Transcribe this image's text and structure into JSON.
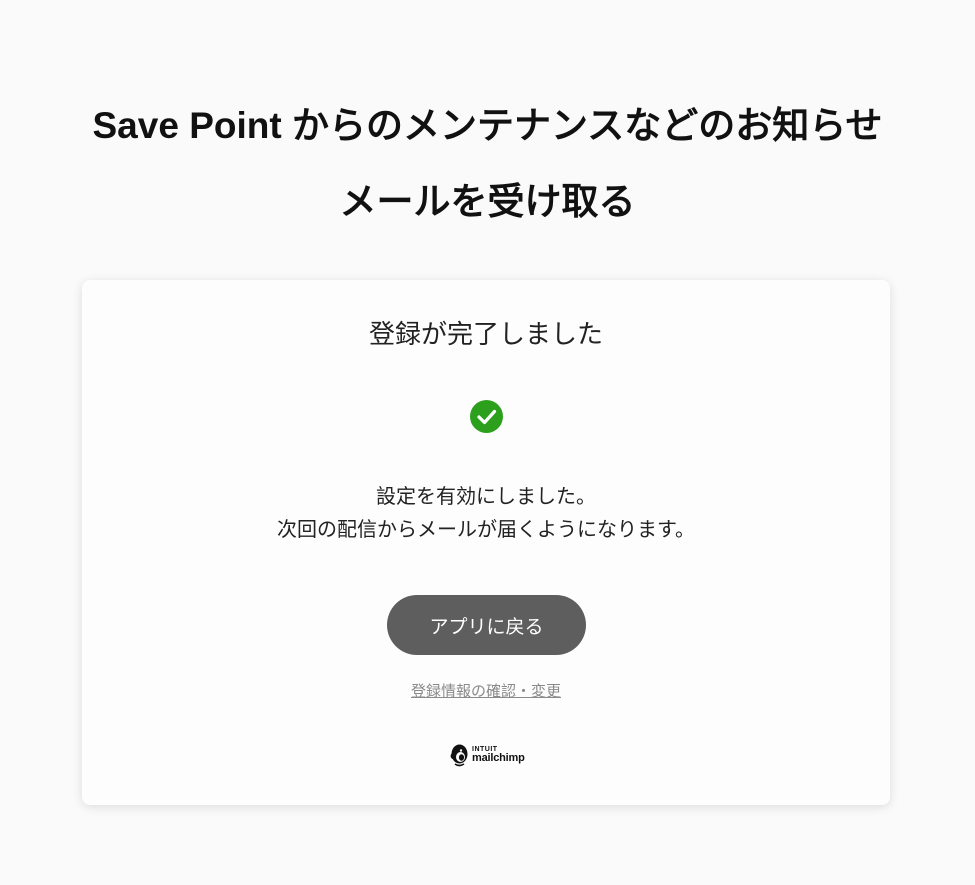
{
  "header": {
    "title_line1": "Save Point からのメンテナンスなどのお知らせ",
    "title_line2": "メールを受け取る"
  },
  "card": {
    "heading": "登録が完了しました",
    "status_icon": "check-circle-icon",
    "message_line1": "設定を有効にしました。",
    "message_line2": "次回の配信からメールが届くようになります。",
    "return_button_label": "アプリに戻る",
    "settings_link_label": "登録情報の確認・変更"
  },
  "footer": {
    "brand_top": "INTUIT",
    "brand_bottom": "mailchimp",
    "brand_icon": "mailchimp-logo-icon"
  },
  "colors": {
    "accent_green": "#2ca01c",
    "button_gray": "#5e5e5e",
    "link_gray": "#8a8a8a"
  }
}
